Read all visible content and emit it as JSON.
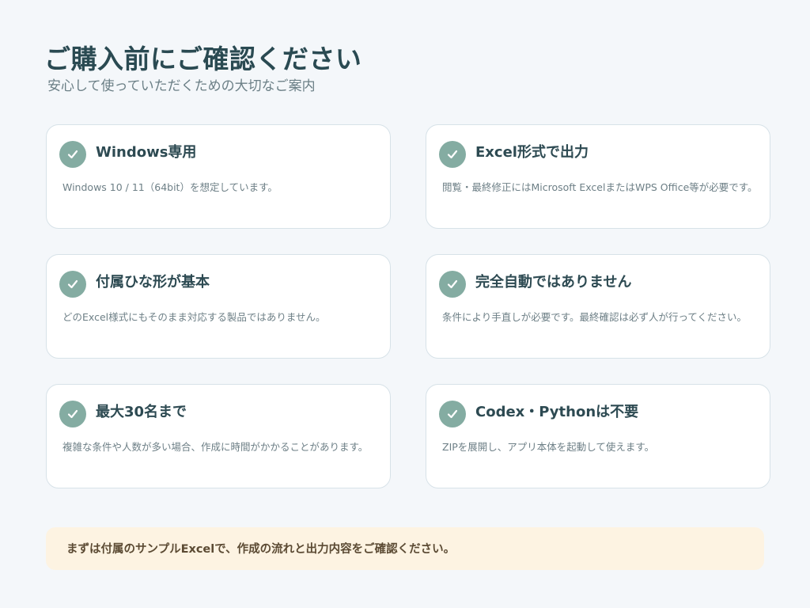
{
  "header": {
    "title": "ご購入前にご確認ください",
    "subtitle": "安心して使っていただくための大切なご案内"
  },
  "cards": [
    {
      "title": "Windows専用",
      "description": "Windows 10 / 11（64bit）を想定しています。"
    },
    {
      "title": "Excel形式で出力",
      "description": "閲覧・最終修正にはMicrosoft ExcelまたはWPS Office等が必要です。"
    },
    {
      "title": "付属ひな形が基本",
      "description": "どのExcel様式にもそのまま対応する製品ではありません。"
    },
    {
      "title": "完全自動ではありません",
      "description": "条件により手直しが必要です。最終確認は必ず人が行ってください。"
    },
    {
      "title": "最大30名まで",
      "description": "複雑な条件や人数が多い場合、作成に時間がかかることがあります。"
    },
    {
      "title": "Codex・Pythonは不要",
      "description": "ZIPを展開し、アプリ本体を起動して使えます。"
    }
  ],
  "notice": {
    "text": "まずは付属のサンプルExcelで、作成の流れと出力内容をご確認ください。"
  },
  "icons": {
    "card_icon": "check-circle-icon"
  },
  "colors": {
    "background": "#f4f7fa",
    "accent": "#84aca2",
    "heading": "#2a4a52",
    "notice_bg": "#fdf3e2"
  }
}
